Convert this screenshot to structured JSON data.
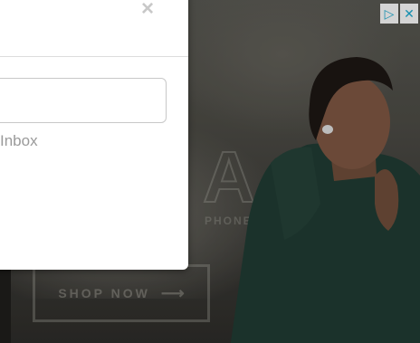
{
  "modal": {
    "close_glyph": "×",
    "input_value": "",
    "inbox_label": "Inbox"
  },
  "ad": {
    "ghost_big": "A",
    "ghost_sub": "PHONES",
    "shop_label": "SHOP NOW",
    "shop_arrow": "⟶",
    "adchoices_glyph": "▷",
    "close_glyph": "✕",
    "icons": [
      "adchoices-icon",
      "ad-close-icon"
    ]
  },
  "colors": {
    "adchoices": "#19a3c8",
    "modal_bg": "#ffffff",
    "jacket": "#1f3d33"
  }
}
